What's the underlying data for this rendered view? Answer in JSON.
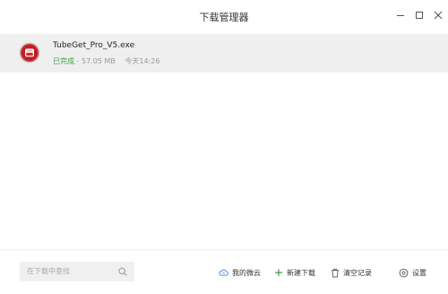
{
  "window": {
    "title": "下载管理器"
  },
  "downloads": [
    {
      "filename": "TubeGet_Pro_V5.exe",
      "status": "已完成",
      "separator": "-",
      "size": "57.05 MB",
      "time": "今天14:26",
      "icon": "tubeget-app-icon"
    }
  ],
  "bottom": {
    "search_placeholder": "在下载中查找",
    "cloud_label": "我的微云",
    "new_download_label": "新建下载",
    "clear_records_label": "清空记录",
    "settings_label": "设置"
  },
  "colors": {
    "status_done": "#3aa24a",
    "row_selected_bg": "#efefef",
    "cloud_icon": "#2d8cf0",
    "new_icon": "#3aa24a",
    "app_icon_red": "#d9282f"
  }
}
